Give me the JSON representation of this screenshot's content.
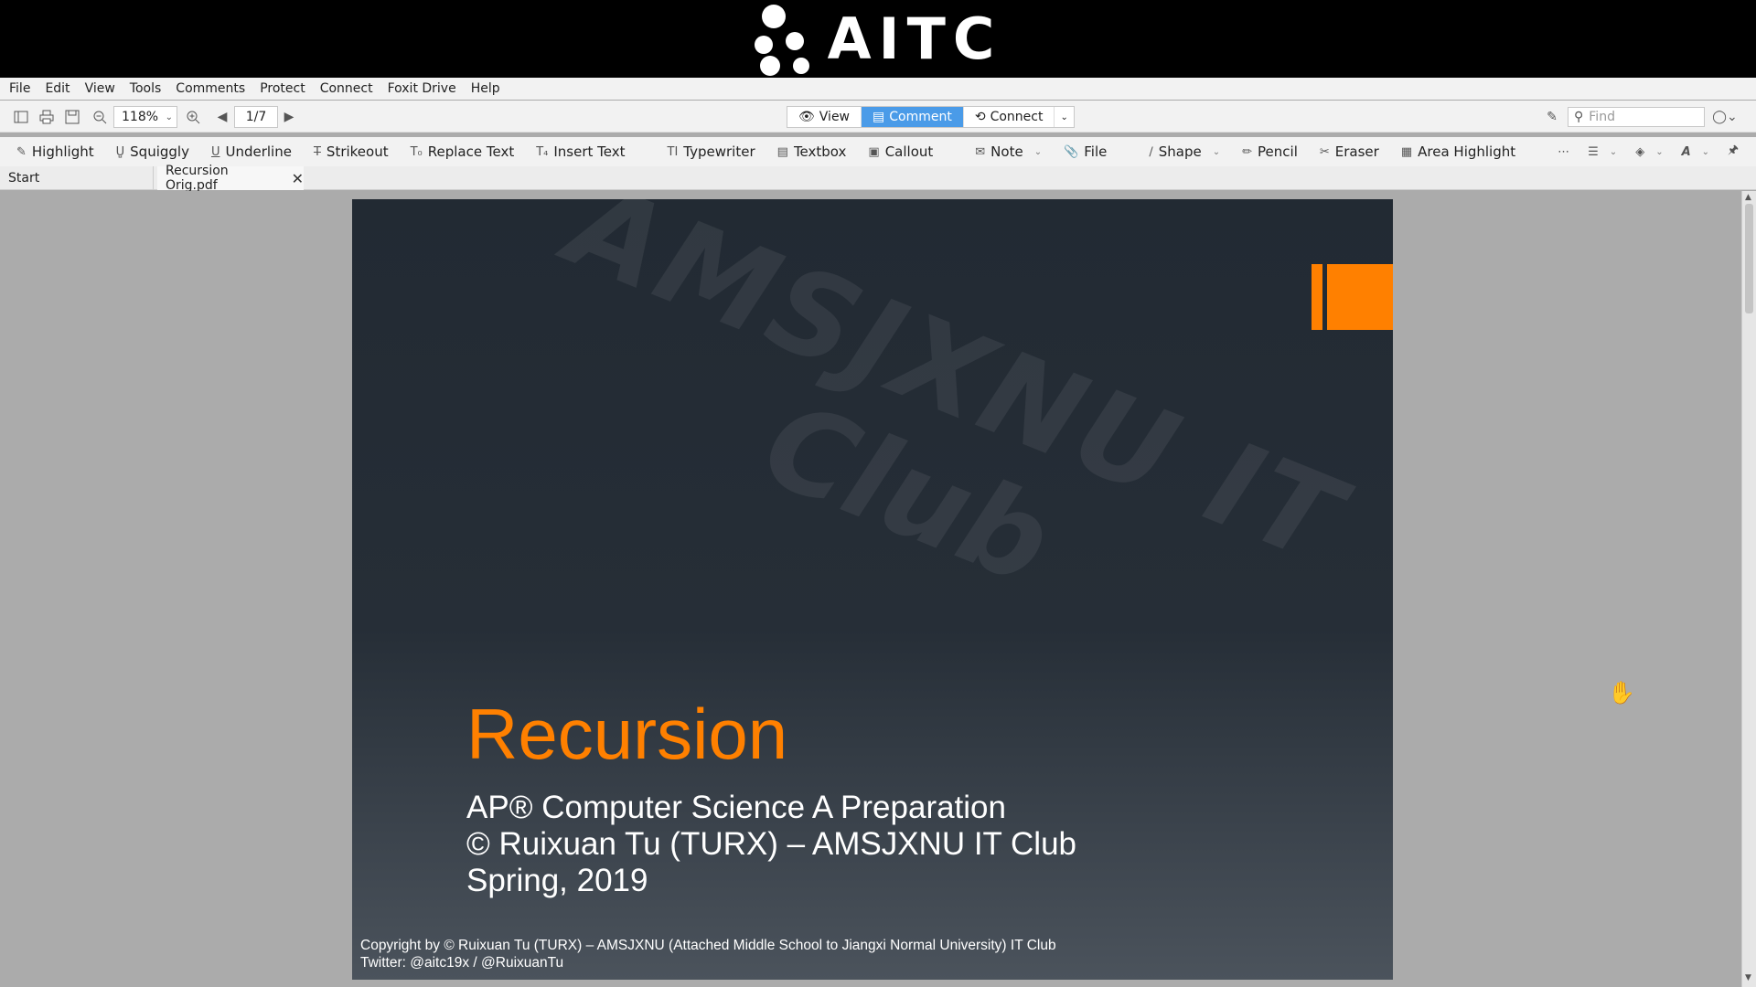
{
  "banner": {
    "logo_text": "AITC"
  },
  "menu": [
    "File",
    "Edit",
    "View",
    "Tools",
    "Comments",
    "Protect",
    "Connect",
    "Foxit Drive",
    "Help"
  ],
  "toolbar": {
    "zoom": "118%",
    "page": "1/7",
    "modes": {
      "view": "View",
      "comment": "Comment",
      "connect": "Connect"
    },
    "find_placeholder": "Find"
  },
  "comment_tools": {
    "highlight": "Highlight",
    "squiggly": "Squiggly",
    "underline": "Underline",
    "strikeout": "Strikeout",
    "replace_text": "Replace Text",
    "insert_text": "Insert Text",
    "typewriter": "Typewriter",
    "textbox": "Textbox",
    "callout": "Callout",
    "note": "Note",
    "file": "File",
    "shape": "Shape",
    "pencil": "Pencil",
    "eraser": "Eraser",
    "area_highlight": "Area Highlight"
  },
  "tabs": {
    "start": "Start",
    "document": "Recursion Orig.pdf"
  },
  "slide": {
    "watermark_line1": "AMSJXNU IT",
    "watermark_line2": "Club",
    "title": "Recursion",
    "subtitle_lines": [
      "AP® Computer Science A Preparation",
      "© Ruixuan Tu (TURX) – AMSJXNU IT Club",
      "Spring, 2019"
    ],
    "footer_lines": [
      "Copyright by © Ruixuan Tu (TURX) – AMSJXNU (Attached Middle School to Jiangxi Normal University) IT Club",
      "Twitter: @aitc19x / @RuixuanTu"
    ],
    "accent_color": "#ff8000"
  },
  "colors": {
    "title_orange": "#ff8000",
    "comment_mode_blue": "#4a9be8"
  }
}
